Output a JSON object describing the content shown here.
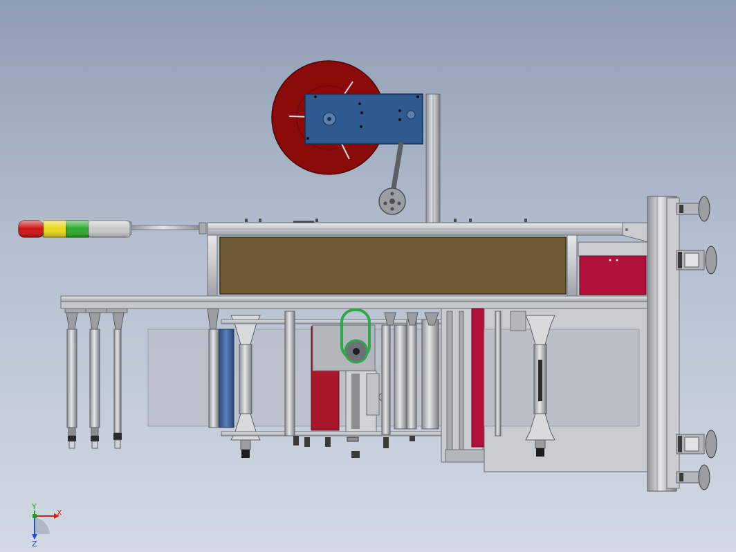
{
  "view": {
    "type": "CAD assembly front view",
    "colors": {
      "background_top": "#8f9db3",
      "background_bottom": "#d2d9e2",
      "frame": "#c9ccd1",
      "frame_edge": "#6b6e73",
      "reel": "#8b0b0b",
      "reel_plate": "#2e5a8f",
      "main_panel": "#6e5a33",
      "side_panel": "#b0103a",
      "red_block": "#a8162c",
      "blue_roller": "#3a5f9a",
      "belt": "#2ea84a",
      "web": "#b9bec7"
    }
  },
  "signal_tower": {
    "segments": [
      "red",
      "yellow",
      "green",
      "gray"
    ],
    "colors": [
      "#cc1111",
      "#e8d81a",
      "#2aa82a",
      "#c8c8c8"
    ]
  },
  "axes_triad": {
    "x_label": "X",
    "y_label": "Y",
    "z_label": "Z",
    "x_color": "#d02020",
    "y_color": "#20a020",
    "z_color": "#2050d0"
  }
}
